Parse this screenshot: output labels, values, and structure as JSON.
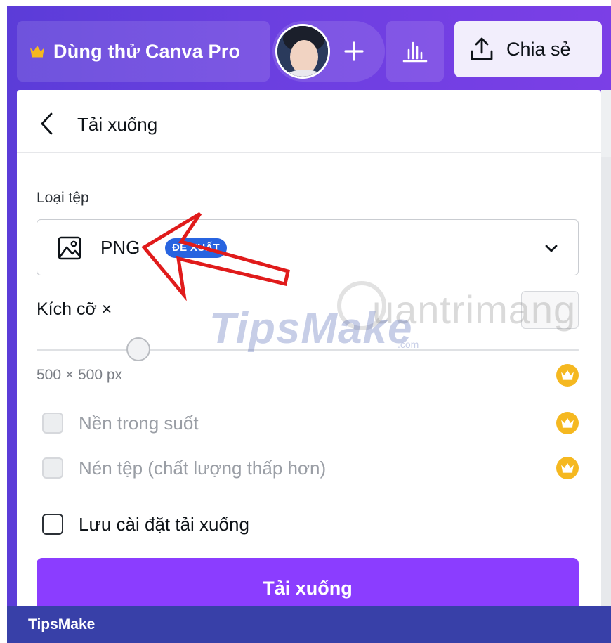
{
  "topbar": {
    "pro_label": "Dùng thử Canva Pro",
    "share_label": "Chia sẻ"
  },
  "panel": {
    "title": "Tải xuống",
    "filetype_label": "Loại tệp",
    "filetype_value": "PNG",
    "recommend_badge": "ĐỀ XUẤT",
    "size_label": "Kích cỡ ×",
    "size_value": "500 × 500 px",
    "option_transparent": "Nền trong suốt",
    "option_compress": "Nén tệp (chất lượng thấp hơn)",
    "option_save_settings": "Lưu cài đặt tải xuống",
    "download_label": "Tải xuống"
  },
  "footer": {
    "label": "TipsMake"
  },
  "watermarks": {
    "tipsmake": "TipsMake",
    "tipsmake_com": ".com",
    "quantrimang": "uantrimang"
  },
  "colors": {
    "header_purple": "#6a3fe0",
    "download_purple": "#8b3dff",
    "recommend_blue": "#2864e0",
    "crown_yellow": "#f5b820",
    "annotation_red": "#e01b1b",
    "footer_blue": "#3840a8"
  }
}
